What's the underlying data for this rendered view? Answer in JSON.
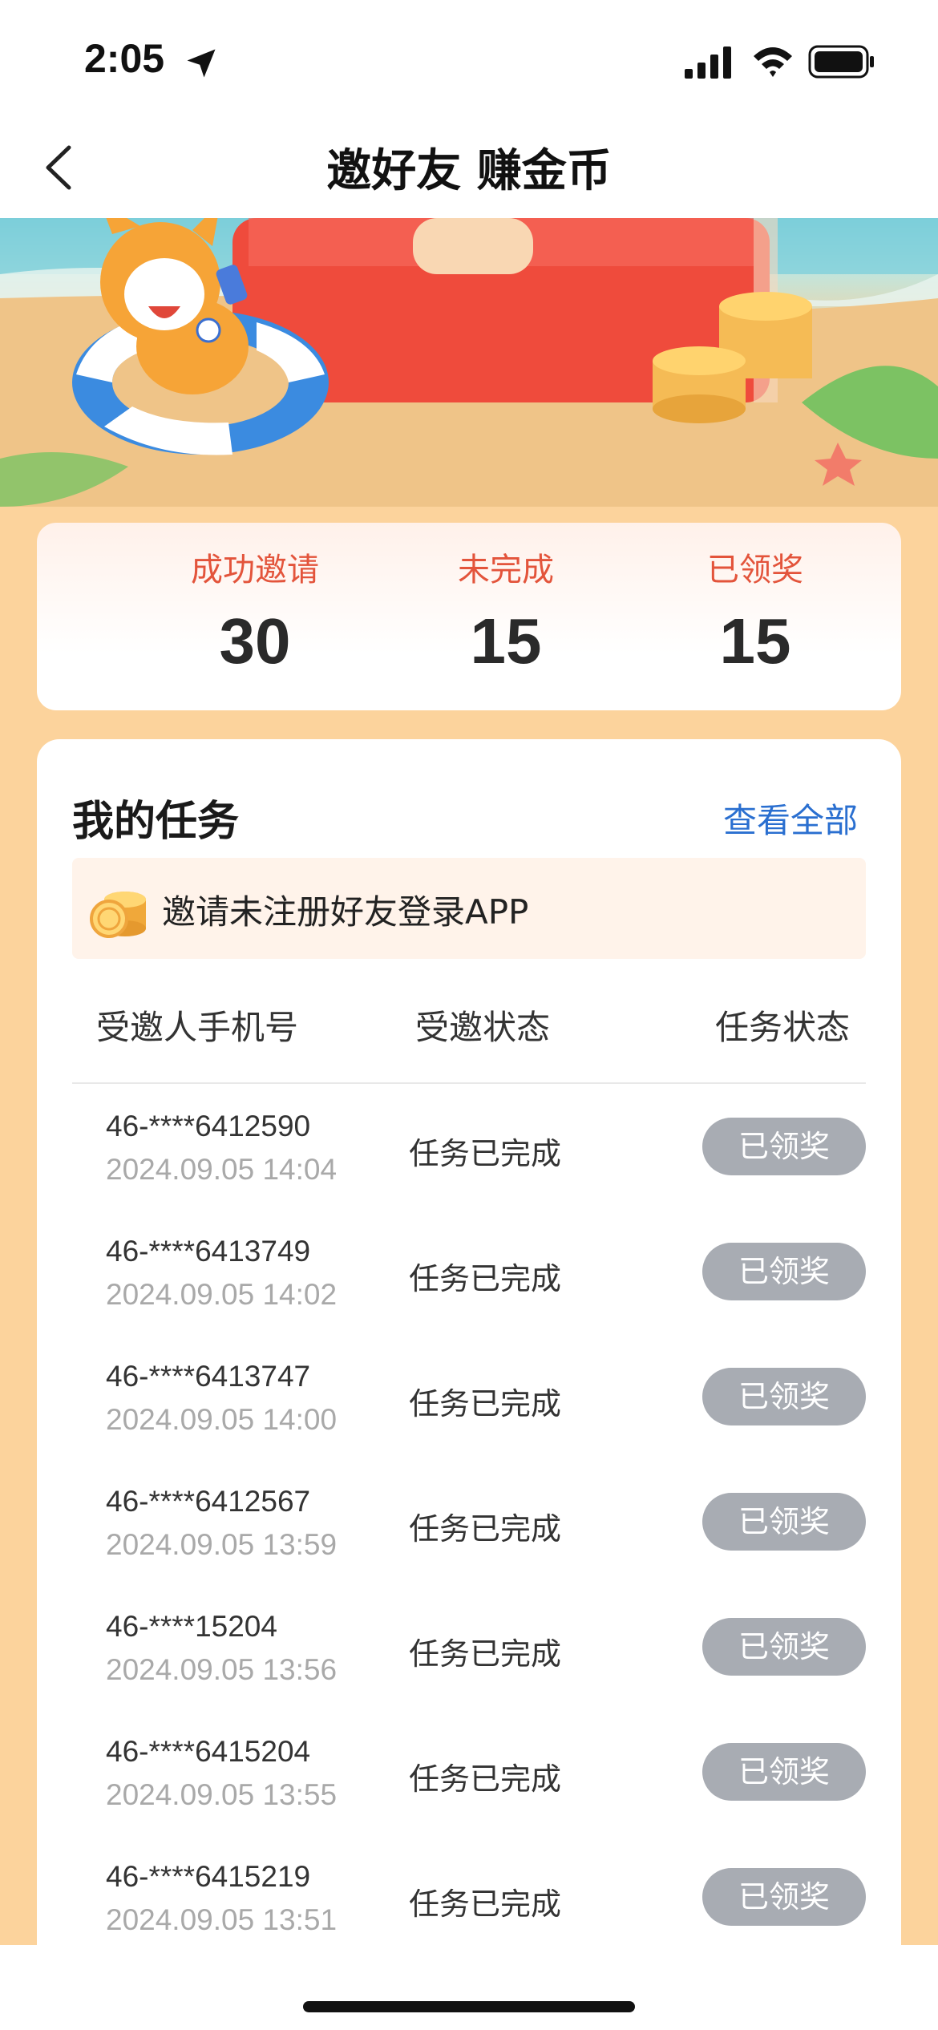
{
  "status_bar": {
    "time": "2:05"
  },
  "nav": {
    "title": "邀好友 赚金币"
  },
  "stats": [
    {
      "label": "成功邀请",
      "value": "30"
    },
    {
      "label": "未完成",
      "value": "15"
    },
    {
      "label": "已领奖",
      "value": "15"
    }
  ],
  "tasks": {
    "title": "我的任务",
    "view_all": "查看全部",
    "banner_text": "邀请未注册好友登录APP",
    "columns": [
      "受邀人手机号",
      "受邀状态",
      "任务状态"
    ],
    "rows": [
      {
        "phone": "46-****6412590",
        "time": "2024.09.05 14:04",
        "status": "任务已完成",
        "action": "已领奖"
      },
      {
        "phone": "46-****6413749",
        "time": "2024.09.05 14:02",
        "status": "任务已完成",
        "action": "已领奖"
      },
      {
        "phone": "46-****6413747",
        "time": "2024.09.05 14:00",
        "status": "任务已完成",
        "action": "已领奖"
      },
      {
        "phone": "46-****6412567",
        "time": "2024.09.05 13:59",
        "status": "任务已完成",
        "action": "已领奖"
      },
      {
        "phone": "46-****15204",
        "time": "2024.09.05 13:56",
        "status": "任务已完成",
        "action": "已领奖"
      },
      {
        "phone": "46-****6415204",
        "time": "2024.09.05 13:55",
        "status": "任务已完成",
        "action": "已领奖"
      },
      {
        "phone": "46-****6415219",
        "time": "2024.09.05 13:51",
        "status": "任务已完成",
        "action": "已领奖"
      }
    ]
  },
  "colors": {
    "page_bg": "#fcd39c",
    "accent_red": "#e3543b",
    "link_blue": "#2a6fd0",
    "claimed_button": "#a8acb3"
  },
  "icons": [
    "location-arrow-icon",
    "signal-icon",
    "wifi-icon",
    "battery-icon",
    "back-chevron-icon",
    "gold-coin-icon"
  ]
}
